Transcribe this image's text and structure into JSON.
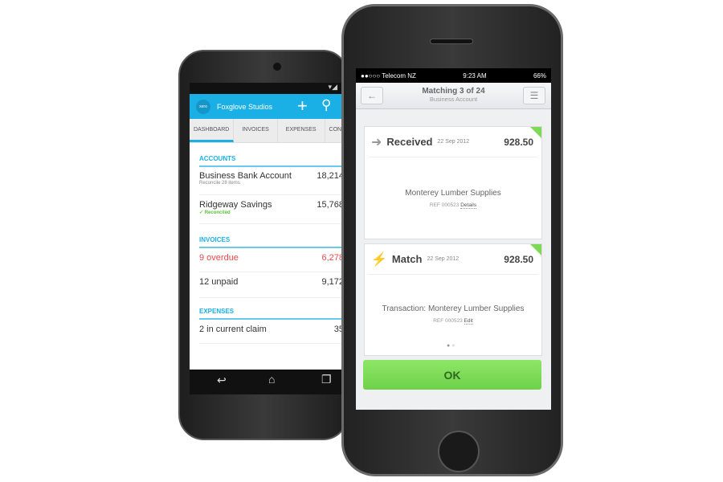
{
  "android": {
    "status_icons": "wifi-signal",
    "app_title": "Foxglove Studios",
    "logo_text": "xero",
    "tabs": [
      "DASHBOARD",
      "INVOICES",
      "EXPENSES",
      "CON"
    ],
    "accounts": {
      "heading": "ACCOUNTS",
      "rows": [
        {
          "name": "Business Bank Account",
          "sub": "Reconcile 28 items",
          "amount": "18,214"
        },
        {
          "name": "Ridgeway Savings",
          "sub": "✓ Reconciled",
          "amount": "15,768"
        }
      ]
    },
    "invoices": {
      "heading": "INVOICES",
      "rows": [
        {
          "name": "9 overdue",
          "amount": "6,278"
        },
        {
          "name": "12 unpaid",
          "amount": "9,172"
        }
      ]
    },
    "expenses": {
      "heading": "EXPENSES",
      "rows": [
        {
          "name": "2 in current claim",
          "amount": "35"
        }
      ]
    },
    "colors": {
      "accent": "#1ab0e6",
      "overdue": "#e84a4a",
      "reconciled": "#5cc23a"
    }
  },
  "iphone": {
    "carrier": "●●○○○ Telecom NZ",
    "time": "9:23 AM",
    "battery": "66%",
    "title": "Matching 3 of 24",
    "subtitle": "Business Account",
    "received": {
      "label": "Received",
      "date": "22 Sep 2012",
      "amount": "928.50",
      "payee": "Monterey Lumber Supplies",
      "ref": "REF 000523",
      "link": "Details"
    },
    "match": {
      "label": "Match",
      "date": "22 Sep 2012",
      "amount": "928.50",
      "payee": "Transaction: Monterey Lumber Supplies",
      "ref": "REF 000523",
      "link": "Edit"
    },
    "ok": "OK",
    "colors": {
      "ok": "#7ed957"
    }
  }
}
